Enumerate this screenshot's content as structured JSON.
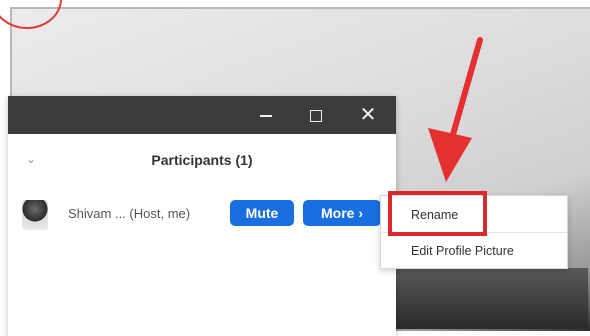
{
  "window": {
    "controls": {
      "minimize": "–",
      "maximize": "□",
      "close": "✕"
    }
  },
  "participants_panel": {
    "title": "Participants (1)",
    "collapse_icon": "chevron-down-icon"
  },
  "participants": [
    {
      "name": "Shivam ... (Host, me)",
      "mute_label": "Mute",
      "more_label": "More ›"
    }
  ],
  "context_menu": {
    "items": [
      {
        "label": "Rename"
      },
      {
        "label": "Edit Profile Picture"
      }
    ]
  },
  "annotations": {
    "highlight_color": "#d92b2b",
    "arrow_color": "#e53030"
  },
  "colors": {
    "button_blue": "#1a6fe0",
    "titlebar": "#3c3c3c"
  }
}
